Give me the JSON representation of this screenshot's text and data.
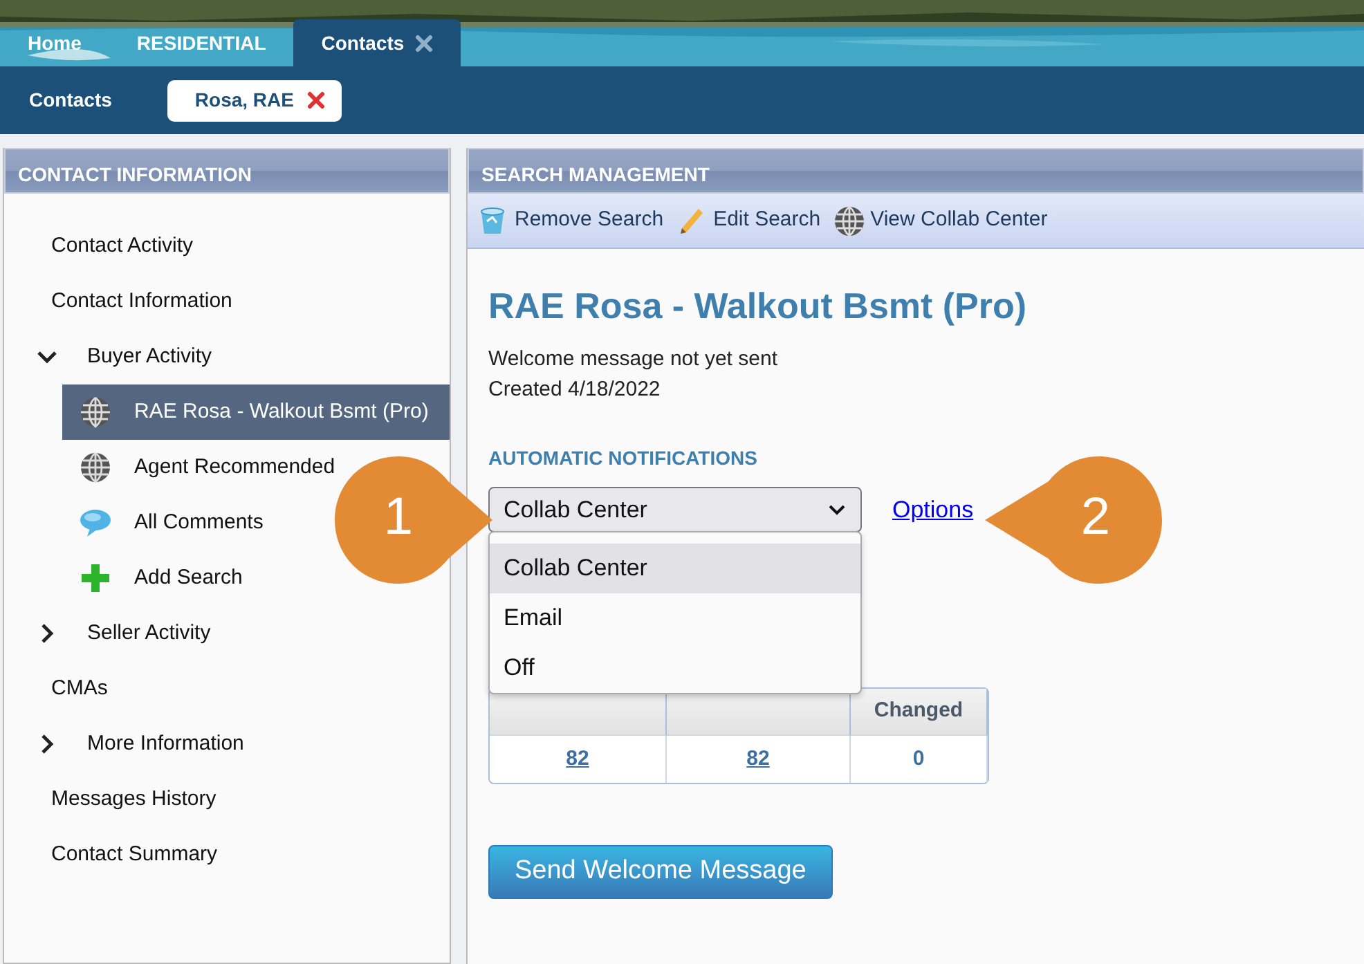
{
  "header_tabs": [
    {
      "label": "Home",
      "selected": false,
      "closable": false
    },
    {
      "label": "RESIDENTIAL",
      "selected": false,
      "closable": false
    },
    {
      "label": "Contacts",
      "selected": true,
      "closable": true
    }
  ],
  "subbar": {
    "title": "Contacts",
    "tabs": [
      {
        "label": "Rosa, RAE",
        "selected": true,
        "closable": true
      }
    ]
  },
  "sidebar": {
    "title": "CONTACT INFORMATION",
    "items": [
      {
        "label": "Contact Activity",
        "kind": "link",
        "selected": false
      },
      {
        "label": "Contact Information",
        "kind": "link",
        "selected": false
      },
      {
        "label": "Buyer Activity",
        "kind": "group",
        "expanded": true,
        "selected": false,
        "children": [
          {
            "label": "RAE Rosa - Walkout Bsmt (Pro)",
            "kind": "search",
            "selected": true
          },
          {
            "label": "Agent Recommended",
            "kind": "search",
            "selected": false
          },
          {
            "label": "All Comments",
            "kind": "comments",
            "selected": false
          },
          {
            "label": "Add Search",
            "kind": "add",
            "selected": false
          }
        ]
      },
      {
        "label": "Seller Activity",
        "kind": "group",
        "expanded": false,
        "selected": false
      },
      {
        "label": "CMAs",
        "kind": "link",
        "selected": false
      },
      {
        "label": "More Information",
        "kind": "group",
        "expanded": false,
        "selected": false
      },
      {
        "label": "Messages History",
        "kind": "link",
        "selected": false
      },
      {
        "label": "Contact Summary",
        "kind": "link",
        "selected": false
      }
    ]
  },
  "main": {
    "title": "SEARCH MANAGEMENT",
    "toolbar": [
      {
        "label": "Remove Search",
        "kind": "remove"
      },
      {
        "label": "Edit Search",
        "kind": "edit"
      },
      {
        "label": "View Collab Center",
        "kind": "collab"
      }
    ],
    "heading": "RAE Rosa - Walkout Bsmt (Pro)",
    "status": "Welcome message not yet sent",
    "created": "Created 4/18/2022",
    "notifications": {
      "title": "AUTOMATIC NOTIFICATIONS",
      "select": {
        "value": "Collab Center",
        "expanded": true,
        "options": [
          {
            "label": "Collab Center",
            "selected": true
          },
          {
            "label": "Email",
            "selected": false
          },
          {
            "label": "Off",
            "selected": false
          }
        ]
      },
      "options_link": "Options"
    },
    "table": {
      "headers": {
        "column_3": "Changed"
      },
      "rows": [
        [
          {
            "text": "82",
            "link": true
          },
          {
            "text": "82",
            "link": true
          },
          {
            "text": "0",
            "link": false
          }
        ]
      ]
    },
    "button": "Send Welcome Message"
  },
  "callouts": [
    {
      "label": "1"
    },
    {
      "label": "2"
    }
  ]
}
